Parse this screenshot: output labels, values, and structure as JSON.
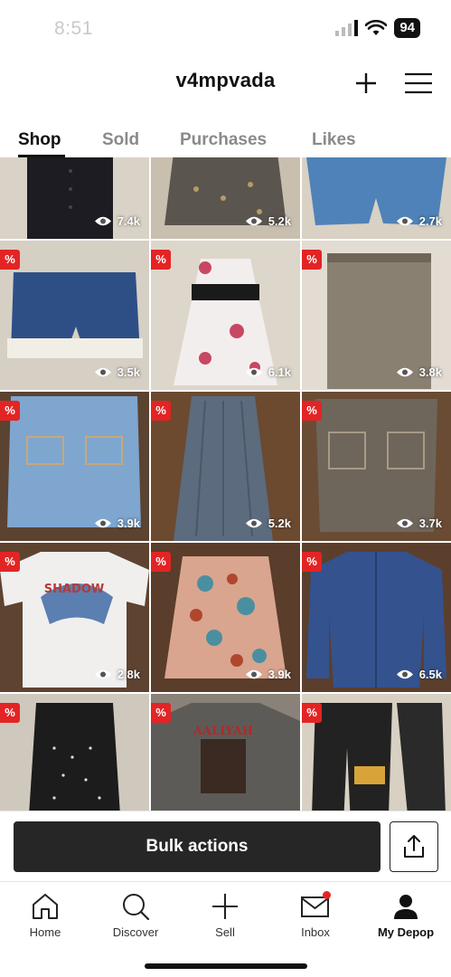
{
  "status": {
    "time": "8:51",
    "battery": "94"
  },
  "header": {
    "username": "v4mpvada"
  },
  "tabs": [
    {
      "label": "Shop",
      "active": true
    },
    {
      "label": "Sold",
      "active": false
    },
    {
      "label": "Purchases",
      "active": false
    },
    {
      "label": "Likes",
      "active": false
    }
  ],
  "grid": {
    "discount_badge": "%",
    "items": [
      {
        "views": "7.4k",
        "discount": false
      },
      {
        "views": "5.2k",
        "discount": false
      },
      {
        "views": "2.7k",
        "discount": false
      },
      {
        "views": "3.5k",
        "discount": true
      },
      {
        "views": "6.1k",
        "discount": true
      },
      {
        "views": "3.8k",
        "discount": true
      },
      {
        "views": "3.9k",
        "discount": true
      },
      {
        "views": "5.2k",
        "discount": true
      },
      {
        "views": "3.7k",
        "discount": true
      },
      {
        "views": "2.8k",
        "discount": true,
        "print_text": "SHADOW"
      },
      {
        "views": "3.9k",
        "discount": true
      },
      {
        "views": "6.5k",
        "discount": true
      },
      {
        "views": "",
        "discount": true
      },
      {
        "views": "",
        "discount": true,
        "print_text": "AALIYAH"
      },
      {
        "views": "",
        "discount": true
      }
    ]
  },
  "actions": {
    "bulk_label": "Bulk actions"
  },
  "nav": [
    {
      "label": "Home",
      "icon": "home-icon",
      "active": false
    },
    {
      "label": "Discover",
      "icon": "search-icon",
      "active": false
    },
    {
      "label": "Sell",
      "icon": "plus-icon",
      "active": false
    },
    {
      "label": "Inbox",
      "icon": "mail-icon",
      "active": false
    },
    {
      "label": "My Depop",
      "icon": "profile-icon",
      "active": true
    }
  ],
  "colors": {
    "accent": "#e32424",
    "primary_button": "#262626"
  }
}
